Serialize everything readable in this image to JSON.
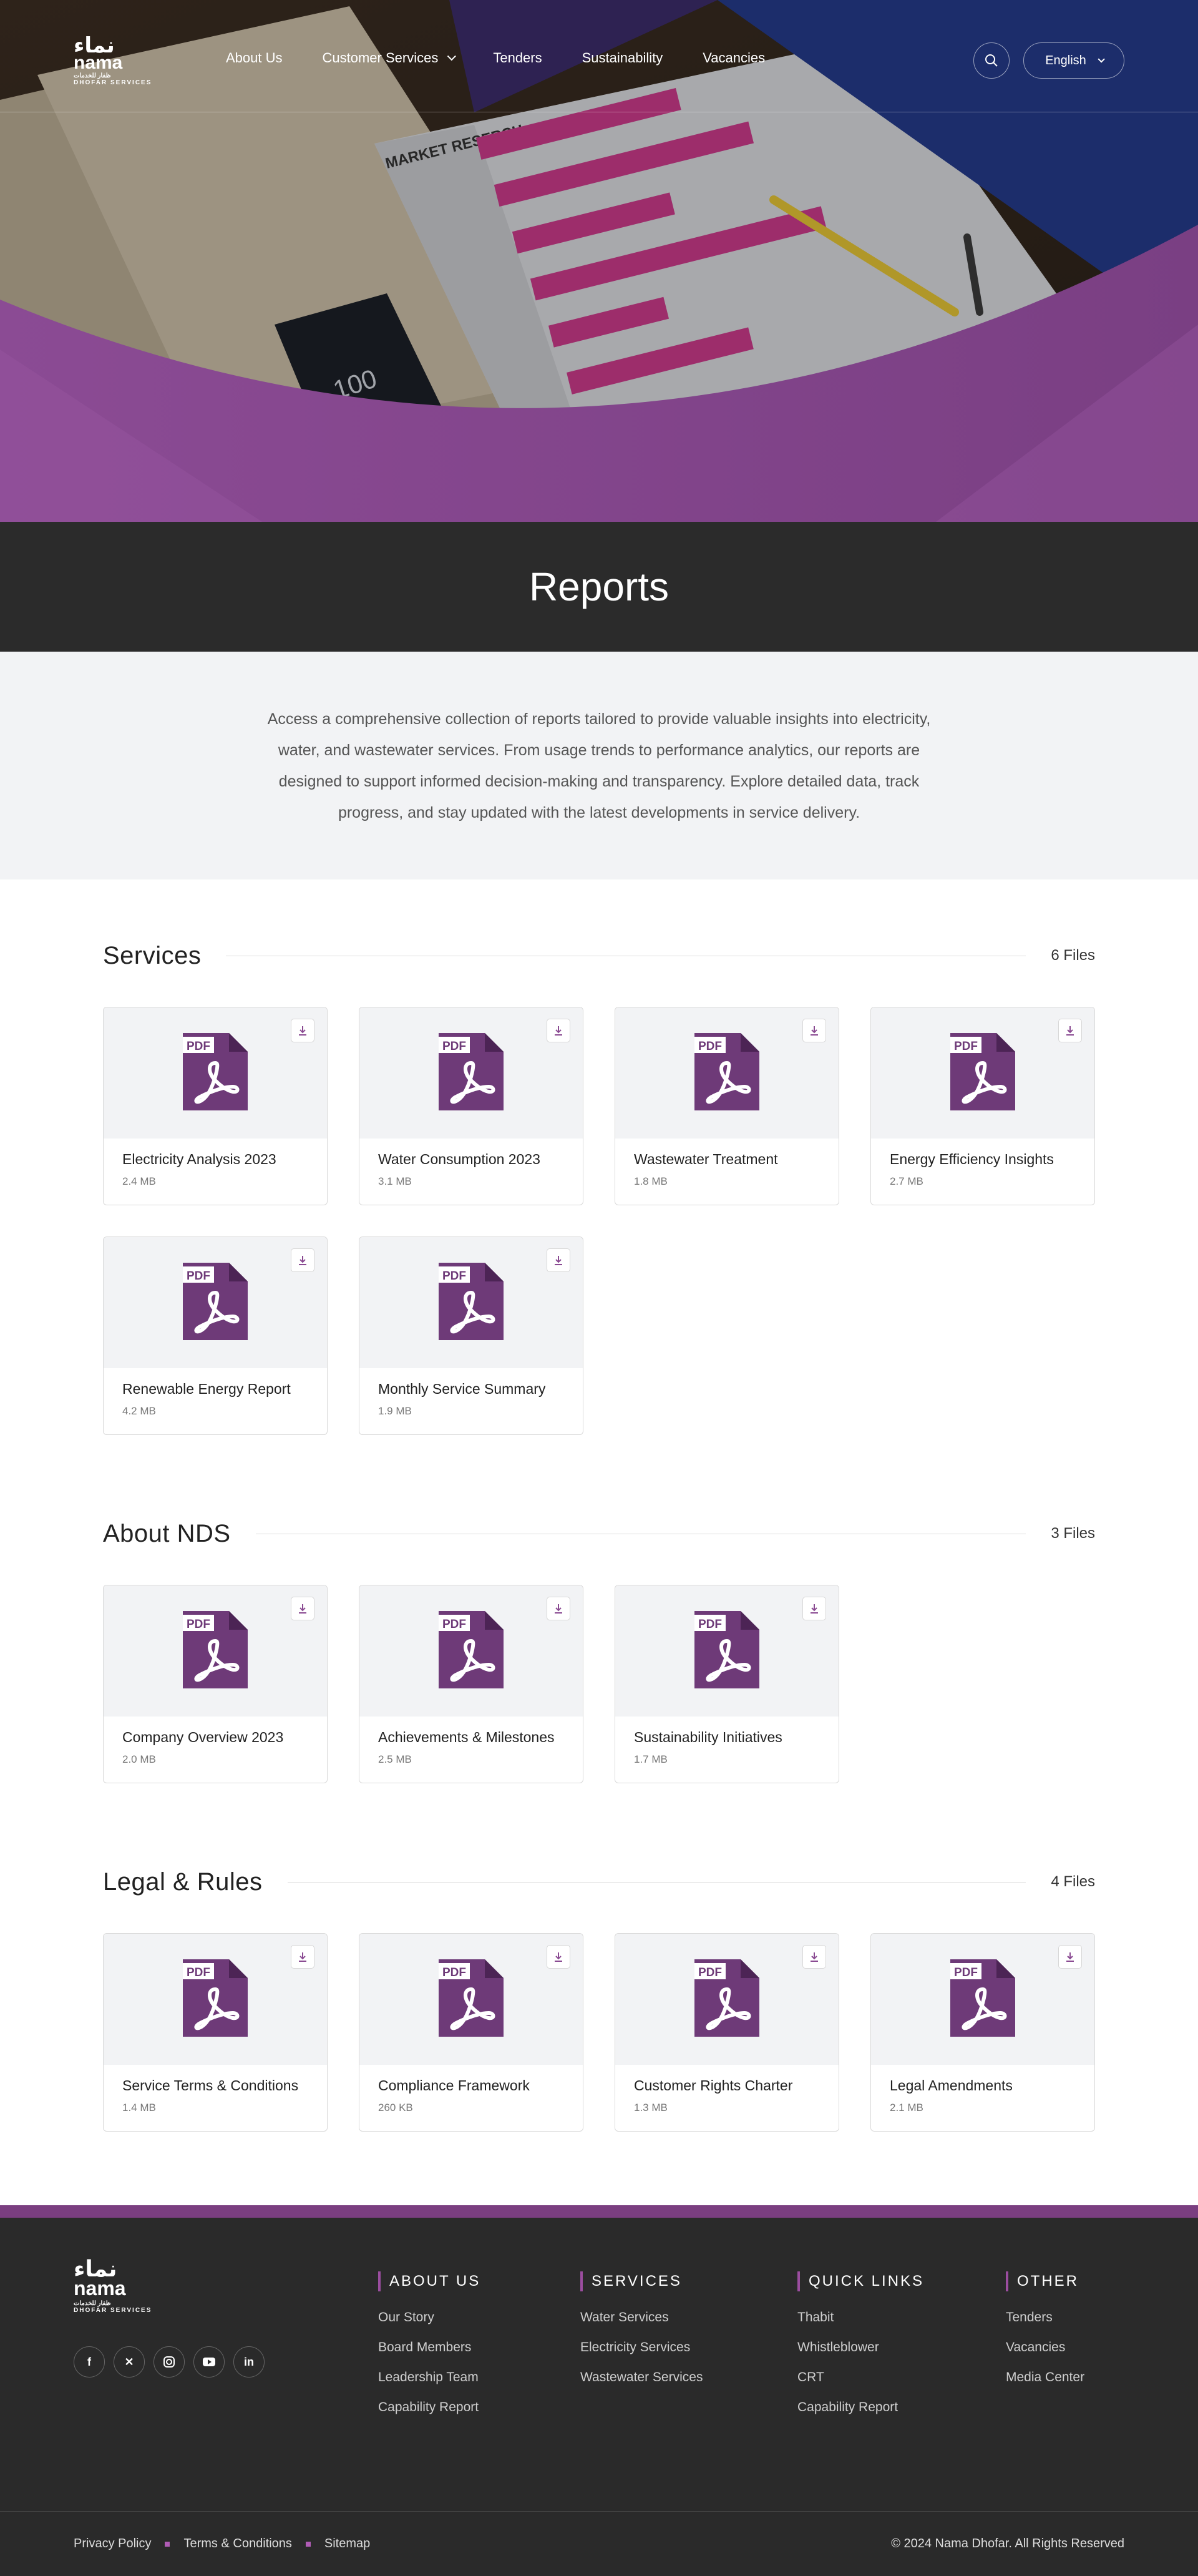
{
  "header": {
    "logo": {
      "arabic": "نماء",
      "name": "nama",
      "arabic_sub": "ظفار للخدمات",
      "sub": "DHOFAR SERVICES"
    },
    "nav": [
      {
        "label": "About Us"
      },
      {
        "label": "Customer Services",
        "has_dropdown": true
      },
      {
        "label": "Tenders"
      },
      {
        "label": "Sustainability"
      },
      {
        "label": "Vacancies"
      }
    ],
    "search_icon": "search-icon",
    "language": "English"
  },
  "hero": {
    "photo_caption": "MARKET RESERCH",
    "phone_display": "100",
    "accent_color": "#8a4a92"
  },
  "page": {
    "title": "Reports",
    "intro": "Access a comprehensive collection of reports tailored to provide valuable insights into electricity, water, and wastewater services. From usage trends to performance analytics, our reports are designed to support informed decision-making and transparency. Explore detailed data, track progress, and stay updated with the latest developments in service delivery."
  },
  "sections": [
    {
      "title": "Services",
      "count": "6 Files",
      "files": [
        {
          "name": "Electricity Analysis 2023",
          "size": "2.4 MB"
        },
        {
          "name": "Water Consumption 2023",
          "size": "3.1 MB"
        },
        {
          "name": "Wastewater Treatment",
          "size": "1.8 MB"
        },
        {
          "name": "Energy Efficiency Insights",
          "size": "2.7 MB"
        },
        {
          "name": "Renewable Energy Report",
          "size": "4.2 MB"
        },
        {
          "name": "Monthly Service Summary",
          "size": "1.9 MB"
        }
      ]
    },
    {
      "title": "About NDS",
      "count": "3 Files",
      "files": [
        {
          "name": "Company Overview 2023",
          "size": "2.0 MB"
        },
        {
          "name": "Achievements & Milestones",
          "size": "2.5 MB"
        },
        {
          "name": "Sustainability Initiatives",
          "size": "1.7 MB"
        }
      ]
    },
    {
      "title": "Legal & Rules",
      "count": "4 Files",
      "files": [
        {
          "name": "Service Terms & Conditions",
          "size": "1.4 MB"
        },
        {
          "name": "Compliance Framework",
          "size": "260 KB"
        },
        {
          "name": "Customer Rights Charter",
          "size": "1.3 MB"
        },
        {
          "name": "Legal Amendments",
          "size": "2.1 MB"
        }
      ]
    }
  ],
  "file_badge": "PDF",
  "pdf_color": "#6e3a78",
  "footer": {
    "logo": {
      "arabic": "نماء",
      "name": "nama",
      "arabic_sub": "ظفار للخدمات",
      "sub": "DHOFAR SERVICES"
    },
    "socials": [
      "facebook-icon",
      "x-icon",
      "instagram-icon",
      "youtube-icon",
      "linkedin-icon"
    ],
    "columns": [
      {
        "title": "ABOUT US",
        "links": [
          "Our Story",
          "Board Members",
          "Leadership Team",
          "Capability Report"
        ]
      },
      {
        "title": "SERVICES",
        "links": [
          "Water Services",
          "Electricity Services",
          "Wastewater Services"
        ]
      },
      {
        "title": "QUICK LINKS",
        "links": [
          "Thabit",
          "Whistleblower",
          "CRT",
          "Capability Report"
        ]
      },
      {
        "title": "OTHER",
        "links": [
          "Tenders",
          "Vacancies",
          "Media Center"
        ]
      }
    ],
    "bottom_links": [
      "Privacy Policy",
      "Terms & Conditions",
      "Sitemap"
    ],
    "copyright": "© 2024 Nama Dhofar. All Rights Reserved"
  }
}
